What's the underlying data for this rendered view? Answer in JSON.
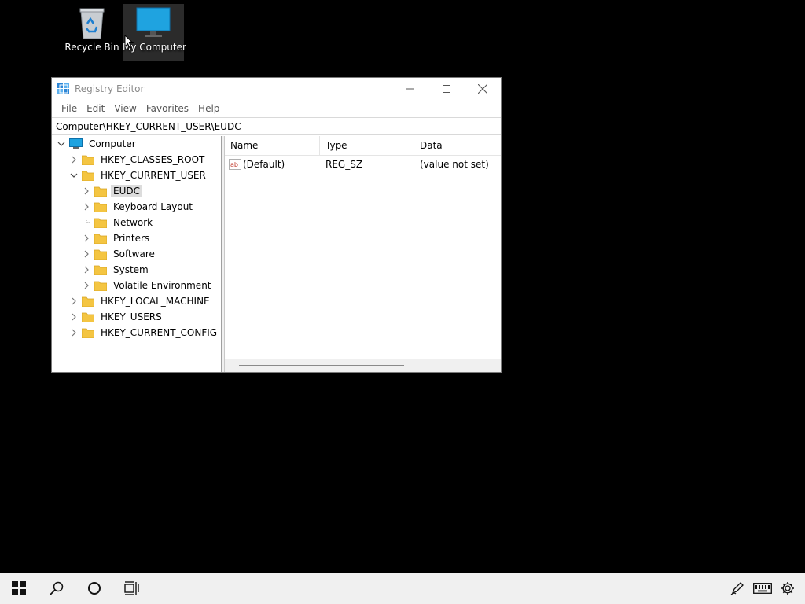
{
  "desktop": {
    "icons": [
      {
        "label": "Recycle Bin",
        "icon": "recycle-bin-icon"
      },
      {
        "label": "My Computer",
        "icon": "monitor-icon"
      }
    ]
  },
  "window": {
    "title": "Registry Editor",
    "menu": [
      "File",
      "Edit",
      "View",
      "Favorites",
      "Help"
    ],
    "address": "Computer\\HKEY_CURRENT_USER\\EUDC",
    "tree": {
      "root": "Computer",
      "nodes": [
        "HKEY_CLASSES_ROOT",
        "HKEY_CURRENT_USER",
        "EUDC",
        "Keyboard Layout",
        "Network",
        "Printers",
        "Software",
        "System",
        "Volatile Environment",
        "HKEY_LOCAL_MACHINE",
        "HKEY_USERS",
        "HKEY_CURRENT_CONFIG"
      ],
      "selected": "EUDC"
    },
    "list": {
      "columns": [
        "Name",
        "Type",
        "Data"
      ],
      "rows": [
        {
          "name": "(Default)",
          "type": "REG_SZ",
          "data": "(value not set)",
          "icon": "string-value-icon"
        }
      ]
    }
  },
  "taskbar": {
    "left": [
      "start-icon",
      "search-icon",
      "cortana-icon",
      "task-view-icon"
    ],
    "tray": [
      "pen-icon",
      "keyboard-icon",
      "settings-icon"
    ]
  },
  "colors": {
    "desktop": "#000000",
    "taskbar": "#f0f0f0",
    "monitor": "#1fa3e0",
    "folder": "#f4c542"
  }
}
